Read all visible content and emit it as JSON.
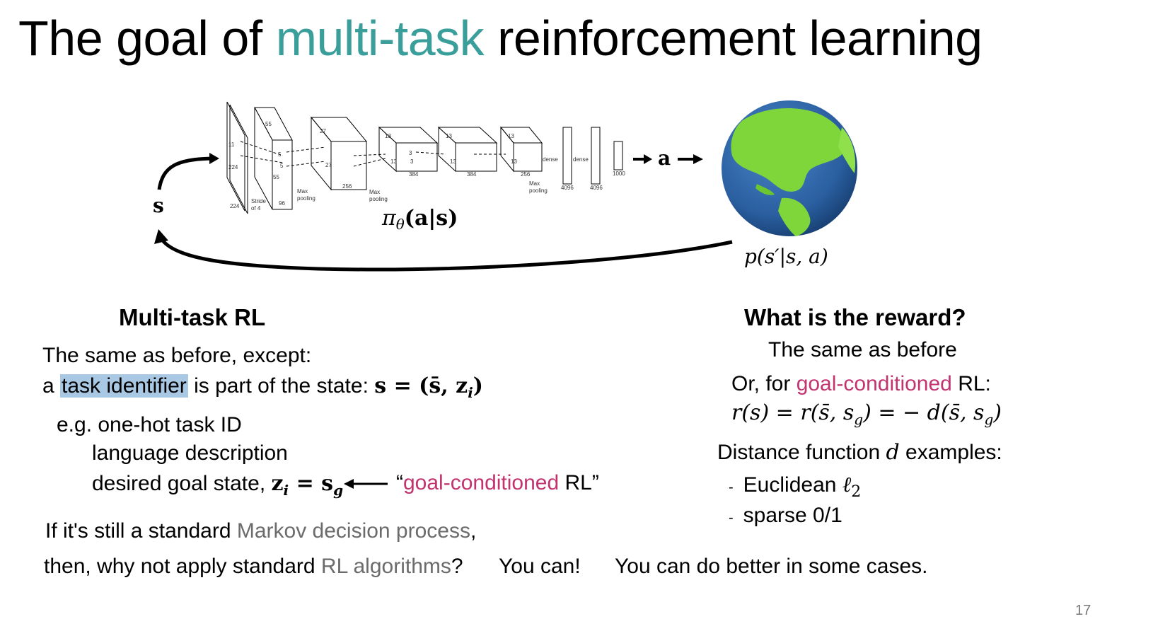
{
  "title": {
    "part1": "The goal of ",
    "highlight": "multi-task",
    "part2": " reinforcement learning"
  },
  "diagram": {
    "state_label": "s",
    "action_label": "a",
    "policy_label": "π",
    "policy_sub": "θ",
    "policy_args": "(a|s)",
    "dynamics_label": "p(s′|s, a)",
    "net_labels": {
      "l11": "11",
      "l224a": "224",
      "l224b": "224",
      "l55a": "55",
      "l55b": "55",
      "l5a": "5",
      "l5b": "5",
      "stride": "Stride",
      "of4": "of 4",
      "l96": "96",
      "maxpool1a": "Max",
      "maxpool1b": "pooling",
      "l27a": "27",
      "l27b": "27",
      "l256a": "256",
      "maxpool2a": "Max",
      "maxpool2b": "pooling",
      "l13a": "13",
      "l13b": "13",
      "l384a": "384",
      "l3a": "3",
      "l3b": "3",
      "l13c": "13",
      "l13d": "13",
      "l384b": "384",
      "l13e": "13",
      "l13f": "13",
      "l256b": "256",
      "maxpool3a": "Max",
      "maxpool3b": "pooling",
      "dense1": "dense",
      "dense2": "dense",
      "l4096a": "4096",
      "l4096b": "4096",
      "l1000": "1000"
    },
    "colors": {
      "ocean": "#2a5fa0",
      "land": "#7fd63a"
    }
  },
  "left": {
    "heading": "Multi-task RL",
    "line1": "The same as before, except:",
    "line2_pre": "a ",
    "line2_hl": "task identifier",
    "line2_post": " is part of the state: ",
    "line2_math": "s = (s̄, z",
    "line2_math_sub": "i",
    "line2_math_end": ")",
    "eg_prefix": "e.g. one-hot task ID",
    "eg2": "language description",
    "eg3_pre": "desired goal state, ",
    "eg3_math": "z",
    "eg3_math_sub1": "i",
    "eg3_math_mid": " = s",
    "eg3_math_sub2": "g",
    "quote_open": "“",
    "quote_pink": "goal-conditioned",
    "quote_rest": " RL”"
  },
  "right": {
    "heading": "What is the reward?",
    "line1": "The same as before",
    "line2_pre": "Or, for ",
    "line2_pink": "goal-conditioned",
    "line2_post": " RL:",
    "formula": "r(s) = r(s̄, s",
    "formula_sub1": "g",
    "formula_mid": ") = − d(s̄, s",
    "formula_sub2": "g",
    "formula_end": ")",
    "dist_pre": "Distance function ",
    "dist_var": "d",
    "dist_post": " examples:",
    "bullet1_pre": "Euclidean ",
    "bullet1_math": "ℓ",
    "bullet1_sub": "2",
    "bullet2": "sparse 0/1",
    "dash": "-"
  },
  "bottom": {
    "line1_pre": "If it's still a standard ",
    "line1_gray": "Markov decision process",
    "line1_post": ",",
    "line2_pre": "then, why not apply standard ",
    "line2_gray": "RL algorithms",
    "line2_post": "?",
    "you_can": "You can!",
    "better": "You can do better in some cases."
  },
  "page_number": "17"
}
